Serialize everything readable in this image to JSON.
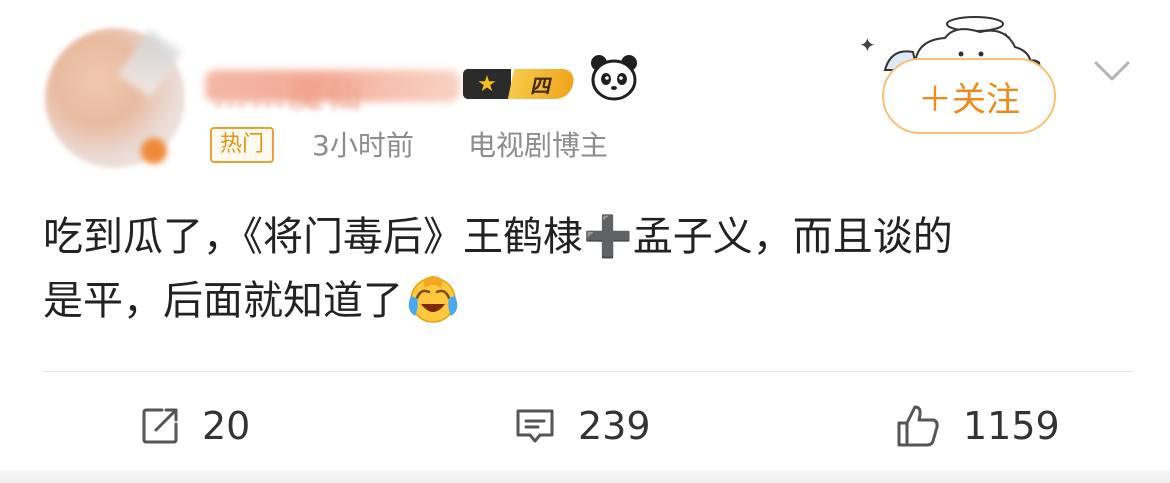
{
  "post": {
    "author": {
      "name": "……魔仙",
      "level": "四",
      "hot_tag": "热门",
      "time": "3小时前",
      "role": "电视剧博主"
    },
    "follow_label": "＋关注",
    "content": {
      "line1_a": "吃到瓜了，《将门毒后》王鹤棣",
      "plus": "➕",
      "line1_b": "孟子义，而且谈的",
      "line2": "是平，后面就知道了"
    },
    "actions": {
      "repost_count": "20",
      "comment_count": "239",
      "like_count": "1159"
    }
  },
  "colors": {
    "accent_orange": "#f08a1c",
    "tag_border": "#e7a233",
    "meta_gray": "#8d8d8d",
    "text": "#222222"
  },
  "icons": [
    "panda-icon",
    "star-icon",
    "chevron-down-icon",
    "laughing-crying-emoji",
    "share-icon",
    "comment-icon",
    "like-icon"
  ]
}
